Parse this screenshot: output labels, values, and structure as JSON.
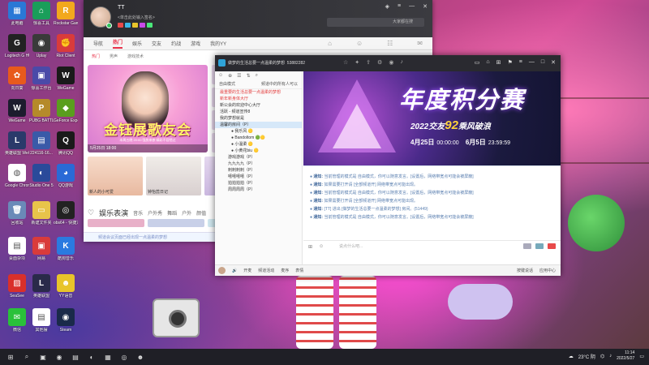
{
  "desktop": {
    "icons": [
      {
        "label": "此电脑",
        "color": "#2a78d6",
        "glyph": "▦"
      },
      {
        "label": "惊喜工具",
        "color": "#1a9e5a",
        "glyph": "⌂"
      },
      {
        "label": "Rockstar Games...",
        "color": "#f2a81d",
        "glyph": "R"
      },
      {
        "label": "Logitech G HUB",
        "color": "#222",
        "glyph": "G"
      },
      {
        "label": "Uplay",
        "color": "#3a3a3a",
        "glyph": "◉"
      },
      {
        "label": "Riot Client",
        "color": "#d93b3b",
        "glyph": "✊"
      },
      {
        "label": "向日葵",
        "color": "#e85a1c",
        "glyph": "✿"
      },
      {
        "label": "惊喜工作台",
        "color": "#4a4aa8",
        "glyph": "▣"
      },
      {
        "label": "WeGame",
        "color": "#1a1a1a",
        "glyph": "W"
      },
      {
        "label": "WeGame",
        "color": "#1c1c2e",
        "glyph": "W"
      },
      {
        "label": "PUBG BATTLEGR...",
        "color": "#b58a2a",
        "glyph": "P"
      },
      {
        "label": "GeForce Experience",
        "color": "#5a9e1e",
        "glyph": "◆"
      },
      {
        "label": "英雄联盟 WeGame版",
        "color": "#2a3a6a",
        "glyph": "L"
      },
      {
        "label": "224116-16...",
        "color": "#3a5aa8",
        "glyph": "▤"
      },
      {
        "label": "腾讯QQ",
        "color": "#1a1a1a",
        "glyph": "Q"
      },
      {
        "label": "Google Chrome",
        "color": "#ffffff",
        "glyph": "◍"
      },
      {
        "label": "Studio One 5",
        "color": "#2a4a9a",
        "glyph": "◐"
      },
      {
        "label": "QQ游戏",
        "color": "#2a6ad6",
        "glyph": "◕"
      },
      {
        "label": "回收站",
        "color": "#6a8ab8",
        "glyph": "🗑"
      },
      {
        "label": "新建文件夹",
        "color": "#e8c44a",
        "glyph": "▭"
      },
      {
        "label": "obs64 - 快捷方式",
        "color": "#222",
        "glyph": "◎"
      },
      {
        "label": "桌面杂项",
        "color": "#ffffff",
        "glyph": "▤"
      },
      {
        "label": "网易",
        "color": "#d93b3b",
        "glyph": "▣"
      },
      {
        "label": "酷狗音乐",
        "color": "#2a7ae0",
        "glyph": "K"
      },
      {
        "label": "SeaSee",
        "color": "#d9302a",
        "glyph": "▨"
      },
      {
        "label": "英雄联盟",
        "color": "#2a2a4a",
        "glyph": "L"
      },
      {
        "label": "YY语音",
        "color": "#e8c42a",
        "glyph": "☻"
      },
      {
        "label": "微信",
        "color": "#2ac13a",
        "glyph": "✉"
      },
      {
        "label": "其他摆",
        "color": "#ffffff",
        "glyph": "▤"
      },
      {
        "label": "Steam",
        "color": "#1a2a4a",
        "glyph": "◉"
      },
      {
        "label": "360日历",
        "color": "#e8a82a",
        "glyph": "▦"
      },
      {
        "label": "YY开播",
        "color": "#f2d43a",
        "glyph": "◔"
      },
      {
        "label": "小黑盒",
        "color": "#ffffff",
        "glyph": "▤"
      }
    ]
  },
  "window_main": {
    "username": "TT",
    "signature": "<单击此处输入签名>",
    "search_placeholder": "大家都在搜",
    "nav": [
      "导航",
      "热门",
      "娱乐",
      "交友",
      "约战",
      "游戏",
      "我的YY"
    ],
    "active_nav": "热门",
    "subnav": [
      "热门",
      "男声",
      "游戏技术"
    ],
    "banner_title": "金钰展歌友会",
    "banner_sub": "本周五晚 20:00 强势来袭 精彩不容错过",
    "banner_caption": "5月25日 18:00",
    "thumbs": [
      {
        "caption": "新人的小可爱",
        "color": "#f3d3c1"
      },
      {
        "caption": "钟怡蕊日记",
        "color": "#e8e0e0"
      },
      {
        "caption": "",
        "color": "#d8c8e8"
      }
    ],
    "section_title": "娱乐表演",
    "section_tabs": [
      "音乐",
      "户外秀",
      "舞蹈",
      "户外",
      "颜值"
    ],
    "bottom_text": "频道会议页面已经出现一点温柔的梦想"
  },
  "window_channel": {
    "channel_title": "做梦的生活总要一点温柔的梦想",
    "channel_id": "53882282",
    "side_header_left": "自由模式",
    "side_header_right": "频道中的所有人可以",
    "channels": [
      {
        "text": "最重要的生活总要一点温柔的梦想",
        "cls": "red"
      },
      {
        "text": "新年新身体大厅",
        "cls": "red"
      },
      {
        "text": "新公会的欢迎中心大厅",
        "cls": ""
      },
      {
        "text": "活跃 - 频道宣传8",
        "cls": ""
      },
      {
        "text": "我的梦想就是",
        "cls": ""
      },
      {
        "text": "温馨的房间（P）",
        "cls": "sel"
      },
      {
        "text": "● 我乐风 🟡",
        "cls": "sub2"
      },
      {
        "text": "● Bandoltom 🟢🟡",
        "cls": "sub2"
      },
      {
        "text": "● 小温柔 🟡",
        "cls": "sub2"
      },
      {
        "text": "● 小黄花biu 🟡",
        "cls": "sub2"
      },
      {
        "text": "游戏游戏（P）",
        "cls": "sub"
      },
      {
        "text": "九九九九（P）",
        "cls": "sub"
      },
      {
        "text": "刺刺刺刺（P）",
        "cls": "sub"
      },
      {
        "text": "嘻嘻嘻嘻（P）",
        "cls": "sub"
      },
      {
        "text": "拍拍拍拍（P）",
        "cls": "sub"
      },
      {
        "text": "周周周周（P）",
        "cls": "sub"
      }
    ],
    "banner": {
      "title": "年度积分赛",
      "subtitle_pre": "2022交友",
      "subtitle_hl": "92",
      "subtitle_post": "乘风破浪",
      "date1": "4月25日",
      "time1": "00:00:00",
      "date2": "6月5日",
      "time2": "23:59:59"
    },
    "messages": [
      {
        "tag": "通知:",
        "text": "当前管理的模式是 自由模式，你可以随意发言。[设置后，网络带宽点可能会被屏蔽]"
      },
      {
        "tag": "通知:",
        "text": "如果需要打开请 [全部频道开] 网络带宽点可能出现。"
      },
      {
        "tag": "通知:",
        "text": "当前管理的模式是 自由模式，你可以随意发言。[设置后，网络带宽点可能会被屏蔽]"
      },
      {
        "tag": "通知:",
        "text": "如果需要打开请 [全部频道开] 网络带宽点可能出现。"
      },
      {
        "tag": "通知:",
        "text": "[TT] 进出 [做梦的生活总要一点温柔的梦想] 房间。(51449)"
      },
      {
        "tag": "通知:",
        "text": "当前管理的模式是 自由模式，你可以随意发言。[设置后，网络带宽点可能会被屏蔽]"
      }
    ],
    "input_placeholder": "说点什么吧...",
    "bottom": [
      "开麦",
      "频道活动",
      "麦序",
      "表情"
    ],
    "bottom_right": [
      "按键说话",
      "应用中心"
    ]
  },
  "taskbar": {
    "weather": "23°C 阴",
    "time": "11:14",
    "date": "2022/5/27"
  }
}
